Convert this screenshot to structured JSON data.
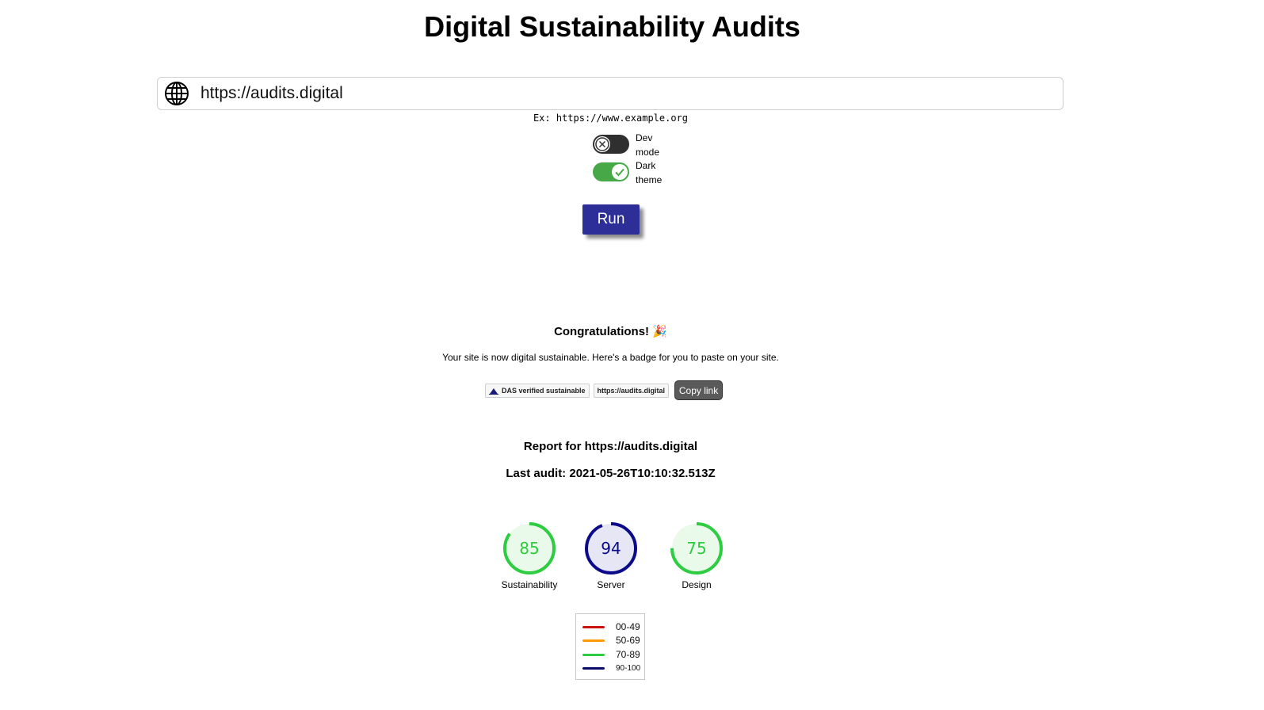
{
  "title": "Digital Sustainability Audits",
  "url_input": {
    "value": "https://audits.digital",
    "icon": "globe-icon"
  },
  "example_hint": "Ex: https://www.example.org",
  "toggles": {
    "dev_mode": {
      "label": "Dev mode",
      "checked": false
    },
    "dark_theme": {
      "label": "Dark theme",
      "checked": true
    }
  },
  "run_label": "Run",
  "congrats": {
    "heading": "Congratulations!",
    "emoji": "🎉",
    "message": "Your site is now digital sustainable. Here's a badge for you to paste on your site.",
    "badge_text": "DAS verified sustainable",
    "badge_url": "https://audits.digital",
    "copy_label": "Copy link"
  },
  "report": {
    "title": "Report for https://audits.digital",
    "last_audit": "Last audit: 2021-05-26T10:10:32.513Z"
  },
  "scores": [
    {
      "label": "Sustainability",
      "value": "85",
      "color": "#2ecc40",
      "fill": "#e9f9ea"
    },
    {
      "label": "Server",
      "value": "94",
      "color": "#0b0b8a",
      "fill": "#e6e6f4"
    },
    {
      "label": "Design",
      "value": "75",
      "color": "#2ecc40",
      "fill": "#e9f9ea"
    }
  ],
  "legend": [
    {
      "range": "00-49",
      "color": "#cc1111"
    },
    {
      "range": "50-69",
      "color": "#ff9900"
    },
    {
      "range": "70-89",
      "color": "#2ecc40"
    },
    {
      "range": "90-100",
      "color": "#0b0b6e"
    }
  ]
}
